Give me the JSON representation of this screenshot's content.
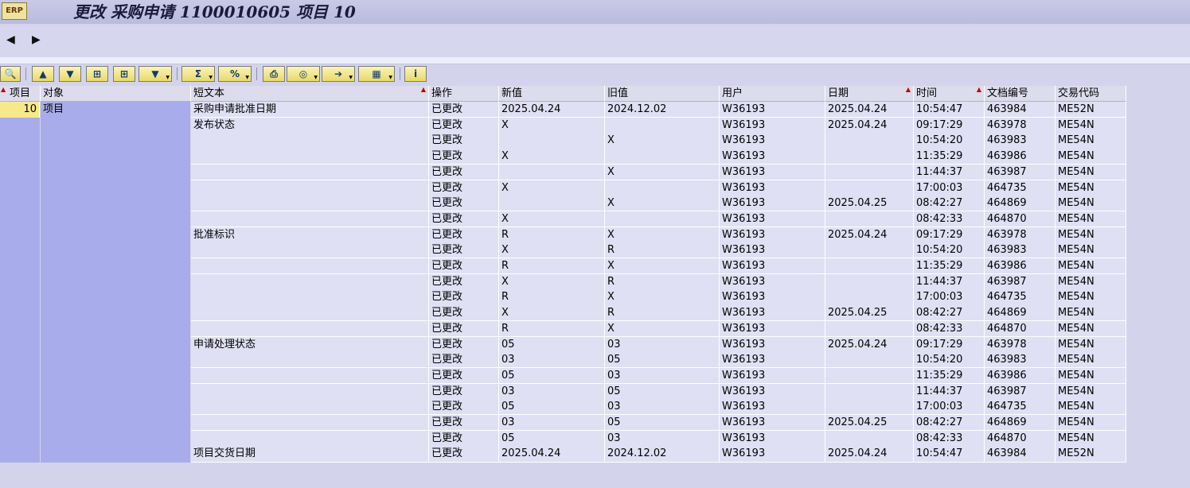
{
  "window": {
    "title": "更改 采购申请 1100010605 项目 10",
    "icon": "transaction-icon"
  },
  "nav": {
    "back_label": "◀",
    "forward_label": "▶"
  },
  "toolbar": {
    "buttons": [
      {
        "name": "details",
        "glyph": "🔍"
      },
      {
        "name": "sort-ascending",
        "glyph": "▲"
      },
      {
        "name": "sort-descending",
        "glyph": "▼"
      },
      {
        "name": "find",
        "glyph": "⊞"
      },
      {
        "name": "find-next",
        "glyph": "⊞"
      },
      {
        "name": "filter",
        "glyph": "▼"
      },
      {
        "name": "sum",
        "glyph": "Σ"
      },
      {
        "name": "subtotal",
        "glyph": "%"
      },
      {
        "name": "print",
        "glyph": "⎙"
      },
      {
        "name": "print-preview",
        "glyph": "◎"
      },
      {
        "name": "export",
        "glyph": "➔"
      },
      {
        "name": "layout",
        "glyph": "▦"
      },
      {
        "name": "info",
        "glyph": "i"
      }
    ]
  },
  "table": {
    "columns": [
      "项目",
      "对象",
      "短文本",
      "操作",
      "新值",
      "旧值",
      "用户",
      "日期",
      "时间",
      "文档编号",
      "交易代码"
    ],
    "item": "10",
    "object": "项目",
    "rows": [
      {
        "short": "采购申请批准日期",
        "op": "已更改",
        "new": "2025.04.24",
        "old": "2024.12.02",
        "user": "W36193",
        "date": "2025.04.24",
        "time": "10:54:47",
        "doc": "463984",
        "tcode": "ME52N"
      },
      {
        "short": "发布状态",
        "op": "已更改",
        "new": "X",
        "old": "",
        "user": "W36193",
        "date": "2025.04.24",
        "time": "09:17:29",
        "doc": "463978",
        "tcode": "ME54N"
      },
      {
        "short": "",
        "op": "已更改",
        "new": "",
        "old": "X",
        "user": "W36193",
        "date": "",
        "time": "10:54:20",
        "doc": "463983",
        "tcode": "ME54N"
      },
      {
        "short": "",
        "op": "已更改",
        "new": "X",
        "old": "",
        "user": "W36193",
        "date": "",
        "time": "11:35:29",
        "doc": "463986",
        "tcode": "ME54N"
      },
      {
        "short": "",
        "op": "已更改",
        "new": "",
        "old": "X",
        "user": "W36193",
        "date": "",
        "time": "11:44:37",
        "doc": "463987",
        "tcode": "ME54N"
      },
      {
        "short": "",
        "op": "已更改",
        "new": "X",
        "old": "",
        "user": "W36193",
        "date": "",
        "time": "17:00:03",
        "doc": "464735",
        "tcode": "ME54N"
      },
      {
        "short": "",
        "op": "已更改",
        "new": "",
        "old": "X",
        "user": "W36193",
        "date": "2025.04.25",
        "time": "08:42:27",
        "doc": "464869",
        "tcode": "ME54N"
      },
      {
        "short": "",
        "op": "已更改",
        "new": "X",
        "old": "",
        "user": "W36193",
        "date": "",
        "time": "08:42:33",
        "doc": "464870",
        "tcode": "ME54N"
      },
      {
        "short": "批准标识",
        "op": "已更改",
        "new": "R",
        "old": "X",
        "user": "W36193",
        "date": "2025.04.24",
        "time": "09:17:29",
        "doc": "463978",
        "tcode": "ME54N"
      },
      {
        "short": "",
        "op": "已更改",
        "new": "X",
        "old": "R",
        "user": "W36193",
        "date": "",
        "time": "10:54:20",
        "doc": "463983",
        "tcode": "ME54N"
      },
      {
        "short": "",
        "op": "已更改",
        "new": "R",
        "old": "X",
        "user": "W36193",
        "date": "",
        "time": "11:35:29",
        "doc": "463986",
        "tcode": "ME54N"
      },
      {
        "short": "",
        "op": "已更改",
        "new": "X",
        "old": "R",
        "user": "W36193",
        "date": "",
        "time": "11:44:37",
        "doc": "463987",
        "tcode": "ME54N"
      },
      {
        "short": "",
        "op": "已更改",
        "new": "R",
        "old": "X",
        "user": "W36193",
        "date": "",
        "time": "17:00:03",
        "doc": "464735",
        "tcode": "ME54N"
      },
      {
        "short": "",
        "op": "已更改",
        "new": "X",
        "old": "R",
        "user": "W36193",
        "date": "2025.04.25",
        "time": "08:42:27",
        "doc": "464869",
        "tcode": "ME54N"
      },
      {
        "short": "",
        "op": "已更改",
        "new": "R",
        "old": "X",
        "user": "W36193",
        "date": "",
        "time": "08:42:33",
        "doc": "464870",
        "tcode": "ME54N"
      },
      {
        "short": "申请处理状态",
        "op": "已更改",
        "new": "05",
        "old": "03",
        "user": "W36193",
        "date": "2025.04.24",
        "time": "09:17:29",
        "doc": "463978",
        "tcode": "ME54N"
      },
      {
        "short": "",
        "op": "已更改",
        "new": "03",
        "old": "05",
        "user": "W36193",
        "date": "",
        "time": "10:54:20",
        "doc": "463983",
        "tcode": "ME54N"
      },
      {
        "short": "",
        "op": "已更改",
        "new": "05",
        "old": "03",
        "user": "W36193",
        "date": "",
        "time": "11:35:29",
        "doc": "463986",
        "tcode": "ME54N"
      },
      {
        "short": "",
        "op": "已更改",
        "new": "03",
        "old": "05",
        "user": "W36193",
        "date": "",
        "time": "11:44:37",
        "doc": "463987",
        "tcode": "ME54N"
      },
      {
        "short": "",
        "op": "已更改",
        "new": "05",
        "old": "03",
        "user": "W36193",
        "date": "",
        "time": "17:00:03",
        "doc": "464735",
        "tcode": "ME54N"
      },
      {
        "short": "",
        "op": "已更改",
        "new": "03",
        "old": "05",
        "user": "W36193",
        "date": "2025.04.25",
        "time": "08:42:27",
        "doc": "464869",
        "tcode": "ME54N"
      },
      {
        "short": "",
        "op": "已更改",
        "new": "05",
        "old": "03",
        "user": "W36193",
        "date": "",
        "time": "08:42:33",
        "doc": "464870",
        "tcode": "ME54N"
      },
      {
        "short": "项目交货日期",
        "op": "已更改",
        "new": "2025.04.24",
        "old": "2024.12.02",
        "user": "W36193",
        "date": "2025.04.24",
        "time": "10:54:47",
        "doc": "463984",
        "tcode": "ME52N"
      }
    ]
  }
}
